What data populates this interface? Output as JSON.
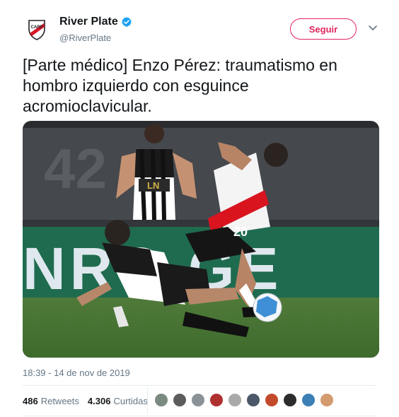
{
  "account": {
    "display_name": "River Plate",
    "handle": "@RiverPlate",
    "verified_icon": "verified-badge-icon",
    "avatar_icon": "river-plate-crest-icon"
  },
  "follow_button": {
    "label": "Seguir"
  },
  "tweet": {
    "text": "[Parte médico] Enzo Pérez: traumatismo en hombro izquierdo con esguince acromioclavicular.",
    "timestamp": "18:39 - 14 de nov de 2019"
  },
  "photo": {
    "stadium_sign_number": "42",
    "banner_letters": "NRO GE",
    "shirt_number": "20",
    "sponsor_text": "LN"
  },
  "stats": {
    "retweets_count": "486",
    "retweets_label": "Retweets",
    "likes_count": "4.306",
    "likes_label": "Curtidas"
  },
  "likers": {
    "count": 10,
    "colors": [
      "#7a8a80",
      "#5c5c5c",
      "#8a9298",
      "#b03030",
      "#a9a9a9",
      "#4a5868",
      "#c24a2a",
      "#2c2c2c",
      "#3b7fb5",
      "#d49a70"
    ]
  },
  "colors": {
    "follow_accent": "#e0245e",
    "verified_blue": "#1da1f2",
    "muted_text": "#657786"
  }
}
